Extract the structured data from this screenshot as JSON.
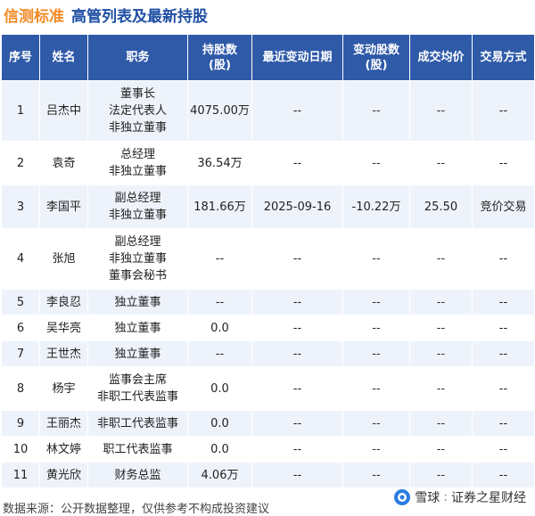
{
  "header": {
    "brand": "信测标准",
    "title": "高管列表及最新持股"
  },
  "table": {
    "columns": [
      "序号",
      "姓名",
      "职务",
      "持股数\n(股)",
      "最近变动日期",
      "变动股数\n(股)",
      "成交均价",
      "交易方式"
    ],
    "rows": [
      {
        "no": "1",
        "name": "吕杰中",
        "positions": [
          "董事长",
          "法定代表人",
          "非独立董事"
        ],
        "shares": "4075.00万",
        "date": "--",
        "change": "--",
        "price": "--",
        "mode": "--"
      },
      {
        "no": "2",
        "name": "袁奇",
        "positions": [
          "总经理",
          "非独立董事"
        ],
        "shares": "36.54万",
        "date": "--",
        "change": "--",
        "price": "--",
        "mode": "--"
      },
      {
        "no": "3",
        "name": "李国平",
        "positions": [
          "副总经理",
          "非独立董事"
        ],
        "shares": "181.66万",
        "date": "2025-09-16",
        "change": "-10.22万",
        "price": "25.50",
        "mode": "竞价交易"
      },
      {
        "no": "4",
        "name": "张旭",
        "positions": [
          "副总经理",
          "非独立董事",
          "董事会秘书"
        ],
        "shares": "--",
        "date": "--",
        "change": "--",
        "price": "--",
        "mode": "--"
      },
      {
        "no": "5",
        "name": "李良忍",
        "positions": [
          "独立董事"
        ],
        "shares": "--",
        "date": "--",
        "change": "--",
        "price": "--",
        "mode": "--"
      },
      {
        "no": "6",
        "name": "吴华亮",
        "positions": [
          "独立董事"
        ],
        "shares": "0.0",
        "date": "--",
        "change": "--",
        "price": "--",
        "mode": "--"
      },
      {
        "no": "7",
        "name": "王世杰",
        "positions": [
          "独立董事"
        ],
        "shares": "--",
        "date": "--",
        "change": "--",
        "price": "--",
        "mode": "--"
      },
      {
        "no": "8",
        "name": "杨宇",
        "positions": [
          "监事会主席",
          "非职工代表监事"
        ],
        "shares": "0.0",
        "date": "--",
        "change": "--",
        "price": "--",
        "mode": "--"
      },
      {
        "no": "9",
        "name": "王丽杰",
        "positions": [
          "非职工代表监事"
        ],
        "shares": "0.0",
        "date": "--",
        "change": "--",
        "price": "--",
        "mode": "--"
      },
      {
        "no": "10",
        "name": "林文婷",
        "positions": [
          "职工代表监事"
        ],
        "shares": "0.0",
        "date": "--",
        "change": "--",
        "price": "--",
        "mode": "--"
      },
      {
        "no": "11",
        "name": "黄光欣",
        "positions": [
          "财务总监"
        ],
        "shares": "4.06万",
        "date": "--",
        "change": "--",
        "price": "--",
        "mode": "--"
      }
    ]
  },
  "footer": {
    "source": "数据来源：公开数据整理，仅供参考不构成投资建议"
  },
  "watermark": {
    "platform": "雪球",
    "account": "证券之星财经",
    "icon": "snowball-logo-icon"
  },
  "colors": {
    "brand": "#f08a24",
    "title": "#1f4fa3",
    "header_bg": "#2f5aa8",
    "row_stripe": "#eef3fb",
    "positive_green": "#2b8a2b"
  }
}
